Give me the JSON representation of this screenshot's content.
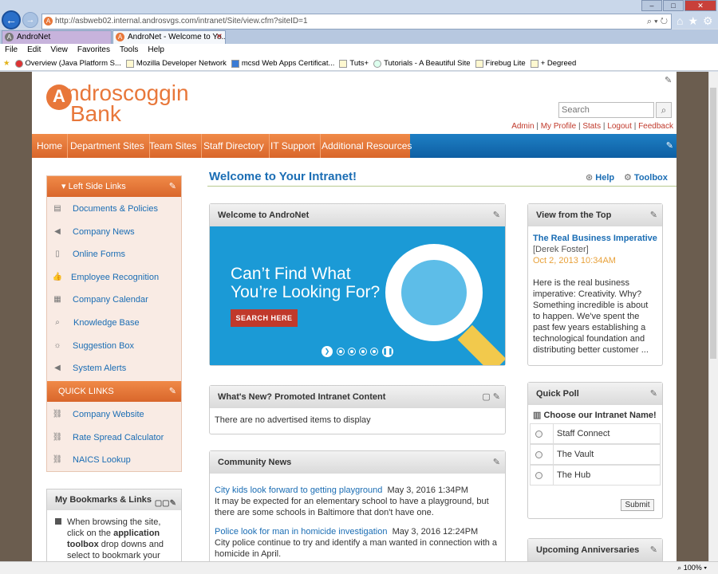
{
  "browser": {
    "url": "http://asbweb02.internal.androsvgs.com/intranet/Site/view.cfm?siteID=1",
    "tabs": [
      {
        "label": "AndroNet"
      },
      {
        "label": "AndroNet - Welcome to Yo..."
      }
    ],
    "menu": [
      "File",
      "Edit",
      "View",
      "Favorites",
      "Tools",
      "Help"
    ],
    "favorites": [
      "Overview (Java Platform S...",
      "Mozilla Developer Network",
      "mcsd Web Apps Certificat...",
      "Tuts+",
      "Tutorials - A Beautiful Site",
      "Firebug Lite",
      "+ Degreed"
    ],
    "zoom": "100%"
  },
  "header": {
    "logo_line1": "ndroscoggin",
    "logo_line2": "Bank",
    "logo_mark": "A",
    "search_placeholder": "Search",
    "user_links": [
      "Admin",
      "My Profile",
      "Stats",
      "Logout",
      "Feedback"
    ]
  },
  "nav": [
    "Home",
    "Department Sites",
    "Team Sites",
    "Staff Directory",
    "IT Support",
    "Additional Resources"
  ],
  "left": {
    "left_side_links_title": "Left Side Links",
    "links": [
      "Documents & Policies",
      "Company News",
      "Online Forms",
      "Employee Recognition",
      "Company Calendar",
      "Knowledge Base",
      "Suggestion Box",
      "System Alerts"
    ],
    "quick_links_title": "QUICK LINKS",
    "quick_links": [
      "Company Website",
      "Rate Spread Calculator",
      "NAICS Lookup"
    ],
    "bookmarks_title": "My Bookmarks & Links",
    "bookmarks_text_1": "When browsing the site, click on the ",
    "bookmarks_bold": "application toolbox",
    "bookmarks_text_2": " drop downs and select to bookmark your favorite"
  },
  "main": {
    "title": "Welcome to Your Intranet!",
    "help": "Help",
    "toolbox": "Toolbox",
    "welcome_panel_title": "Welcome to AndroNet",
    "banner_line1": "Can’t Find What",
    "banner_line2": "You’re Looking For?",
    "banner_button": "SEARCH HERE",
    "whatsnew_title": "What's New? Promoted Intranet Content",
    "whatsnew_body": "There are no advertised items to display",
    "community_title": "Community News",
    "news": [
      {
        "title": "City kids look forward to getting playground",
        "date": "May 3, 2016 1:34PM",
        "body": "It may be expected for an elementary school to have a playground, but there are some schools in Baltimore that don't have one."
      },
      {
        "title": "Police look for man in homicide investigation",
        "date": "May 3, 2016 12:24PM",
        "body": "City police continue to try and identify a man wanted in connection with a homicide in April."
      }
    ]
  },
  "right": {
    "vft_title": "View from the Top",
    "vft_article": "The Real Business Imperative",
    "vft_author": "[Derek Foster]",
    "vft_date": "Oct 2, 2013 10:34AM",
    "vft_body": "Here is the real business imperative: Creativity. Why? Something incredible is about to happen. We've spent the past few years establishing a technological foundation and distributing better customer ...",
    "poll_title": "Quick Poll",
    "poll_question": "Choose our Intranet Name!",
    "poll_options": [
      "Staff Connect",
      "The Vault",
      "The Hub"
    ],
    "poll_submit": "Submit",
    "anniv_title": "Upcoming Anniversaries"
  },
  "colors": {
    "brand_orange": "#e8773a",
    "link_blue": "#1a6db4",
    "nav_blue": "#0e5fa3"
  }
}
